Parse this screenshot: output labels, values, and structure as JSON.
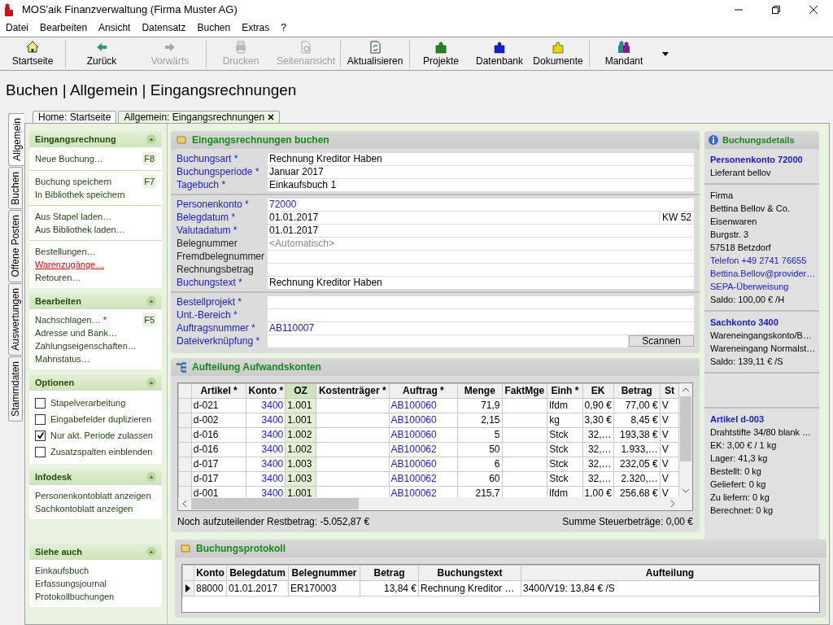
{
  "window": {
    "title": "MOS'aik Finanzverwaltung (Firma Muster AG)"
  },
  "menu": [
    "Datei",
    "Bearbeiten",
    "Ansicht",
    "Datensatz",
    "Buchen",
    "Extras",
    "?"
  ],
  "toolbar": [
    {
      "label": "Startseite",
      "disabled": false
    },
    {
      "label": "Zurück",
      "disabled": false
    },
    {
      "label": "Vorwärts",
      "disabled": true
    },
    {
      "label": "Drucken",
      "disabled": true
    },
    {
      "label": "Seitenansicht",
      "disabled": true
    },
    {
      "label": "Aktualisieren",
      "disabled": false
    },
    {
      "label": "Projekte",
      "color": "#1a8a1a",
      "disabled": false
    },
    {
      "label": "Datenbank",
      "color": "#1020d0",
      "disabled": false
    },
    {
      "label": "Dokumente",
      "color": "#e8d800",
      "disabled": false
    },
    {
      "label": "Mandant",
      "disabled": false
    }
  ],
  "heading": "Buchen | Allgemein | Eingangsrechnungen",
  "side_tabs": [
    {
      "label": "Allgemein",
      "selected": true
    },
    {
      "label": "Buchen",
      "selected": false
    },
    {
      "label": "Offene Posten",
      "selected": false
    },
    {
      "label": "Auswertungen",
      "selected": false
    },
    {
      "label": "Stammdaten",
      "selected": false
    }
  ],
  "doc_tabs": [
    {
      "label": "Home: Startseite",
      "selected": false,
      "closable": false
    },
    {
      "label": "Allgemein: Eingangsrechnungen",
      "selected": true,
      "closable": true
    }
  ],
  "sidebar": [
    {
      "title": "Eingangsrechnung",
      "expanded": true,
      "groups": [
        [
          {
            "kind": "link",
            "text": "Neue Buchung…",
            "shortcut": "F8"
          }
        ],
        [
          {
            "kind": "link",
            "text": "Buchung speichern",
            "shortcut": "F7"
          },
          {
            "kind": "link",
            "text": "In Bibliothek speichern"
          }
        ],
        [
          {
            "kind": "link",
            "text": "Aus Stapel laden…"
          },
          {
            "kind": "link",
            "text": "Aus Bibliothek laden…"
          }
        ],
        [
          {
            "kind": "link",
            "text": "Bestellungen…"
          },
          {
            "kind": "link",
            "text": "Warenzugänge…",
            "hover": true
          },
          {
            "kind": "link",
            "text": "Retouren…"
          }
        ]
      ]
    },
    {
      "title": "Bearbeiten",
      "expanded": true,
      "groups": [
        [
          {
            "kind": "link",
            "text": "Nachschlagen… *",
            "shortcut": "F5"
          },
          {
            "kind": "link",
            "text": "Adresse und Bank…"
          },
          {
            "kind": "link",
            "text": "Zahlungseigenschaften…"
          },
          {
            "kind": "link",
            "text": "Mahnstatus…"
          }
        ]
      ]
    },
    {
      "title": "Optionen",
      "expanded": true,
      "groups": [
        [
          {
            "kind": "checkbox",
            "text": "Stapelverarbeitung",
            "checked": false
          },
          {
            "kind": "checkbox",
            "text": "Eingabefelder duplizieren",
            "checked": false
          },
          {
            "kind": "checkbox",
            "text": "Nur akt. Periode zulassen",
            "checked": true
          },
          {
            "kind": "checkbox",
            "text": "Zusatzspalten einblenden",
            "checked": false
          }
        ]
      ]
    },
    {
      "title": "Infodesk",
      "expanded": true,
      "groups": [
        [
          {
            "kind": "link",
            "text": "Personenkontoblatt anzeigen"
          },
          {
            "kind": "link",
            "text": "Sachkontoblatt anzeigen"
          }
        ]
      ]
    },
    {
      "title": "Siehe auch",
      "expanded": true,
      "groups": [
        [
          {
            "kind": "link",
            "text": "Einkaufsbuch"
          },
          {
            "kind": "link",
            "text": "Erfassungsjournal"
          },
          {
            "kind": "link",
            "text": "Protokollbuchungen"
          }
        ]
      ]
    }
  ],
  "form": {
    "title": "Eingangsrechnungen buchen",
    "groups": [
      [
        {
          "label": "Buchungsart *",
          "required": true,
          "value": "Rechnung Kreditor Haben"
        },
        {
          "label": "Buchungsperiode *",
          "required": true,
          "value": "Januar 2017"
        },
        {
          "label": "Tagebuch *",
          "required": true,
          "value": "Einkaufsbuch 1"
        }
      ],
      [
        {
          "label": "Personenkonto *",
          "required": true,
          "value": "72000",
          "link": true
        },
        {
          "label": "Belegdatum *",
          "required": true,
          "value": "01.01.2017",
          "suffix": "KW 52"
        },
        {
          "label": "Valutadatum *",
          "required": true,
          "value": "01.01.2017"
        },
        {
          "label": "Belegnummer",
          "required": false,
          "placeholder": "<Automatisch>"
        },
        {
          "label": "Fremdbelegnummer",
          "required": false
        },
        {
          "label": "Rechnungsbetrag",
          "required": false
        },
        {
          "label": "Buchungstext *",
          "required": true,
          "value": "Rechnung Kreditor Haben"
        }
      ],
      [
        {
          "label": "Bestellprojekt *",
          "required": true
        },
        {
          "label": "Unt.-Bereich *",
          "required": true
        },
        {
          "label": "Auftragsnummer *",
          "required": true,
          "value": "AB110007",
          "link": true
        },
        {
          "label": "Dateiverknüpfung *",
          "required": true,
          "button": "Scannen"
        }
      ]
    ]
  },
  "split": {
    "title": "Aufteilung Aufwandskonten",
    "columns": [
      {
        "label": "Artikel *"
      },
      {
        "label": "Konto *",
        "link": true
      },
      {
        "label": "OZ",
        "highlight": true
      },
      {
        "label": "Kostenträger *"
      },
      {
        "label": "Auftrag *",
        "link": true
      },
      {
        "label": "Menge"
      },
      {
        "label": "FaktMge"
      },
      {
        "label": "Einh *"
      },
      {
        "label": "EK"
      },
      {
        "label": "Betrag"
      },
      {
        "label": "St"
      }
    ],
    "rows": [
      [
        "d-021",
        "3400",
        "1.001",
        "",
        "AB100060",
        "71,9",
        "",
        "lfdm",
        "0,90 €",
        "77,00 €",
        "V"
      ],
      [
        "d-002",
        "3400",
        "1.001",
        "",
        "AB100060",
        "2,15",
        "",
        "kg",
        "3,30 €",
        "8,45 €",
        "V"
      ],
      [
        "d-016",
        "3400",
        "1.002",
        "",
        "AB100060",
        "5",
        "",
        "Stck",
        "32,…",
        "193,38 €",
        "V"
      ],
      [
        "d-016",
        "3400",
        "1.002",
        "",
        "AB100062",
        "50",
        "",
        "Stck",
        "32,…",
        "1.933,…",
        "V"
      ],
      [
        "d-017",
        "3400",
        "1.003",
        "",
        "AB100060",
        "6",
        "",
        "Stck",
        "32,…",
        "232,05 €",
        "V"
      ],
      [
        "d-017",
        "3400",
        "1.003",
        "",
        "AB100062",
        "60",
        "",
        "Stck",
        "32,…",
        "2.320,…",
        "V"
      ],
      [
        "d-001",
        "3400",
        "1.001",
        "",
        "AB100062",
        "215,7",
        "",
        "lfdm",
        "1,00 €",
        "256,68 €",
        "V"
      ]
    ],
    "remaining": "Noch aufzuteilender Restbetrag: -5.052,87 €",
    "tax_sum": "Summe Steuerbeträge: 0,00 €"
  },
  "details": {
    "title": "Buchungsdetails",
    "sections": [
      {
        "title": "Personenkonto 72000",
        "lines": [
          {
            "text": "Lieferant bellov"
          }
        ]
      },
      {
        "lines": [
          {
            "text": "Firma"
          },
          {
            "text": "Bettina Bellov & Co."
          },
          {
            "text": "Eisenwaren"
          },
          {
            "text": "Burgstr. 3"
          },
          {
            "text": "57518 Betzdorf"
          },
          {
            "text": "Telefon +49 2741 76655",
            "link": true
          },
          {
            "text": "Bettina.Bellov@provider…",
            "link": true
          },
          {
            "text": "SEPA-Überweisung",
            "link": true
          },
          {
            "text": "Saldo: 100,00 € /H"
          }
        ]
      },
      {
        "title": "Sachkonto 3400",
        "lines": [
          {
            "text": "Wareneingangskonto/B…"
          },
          {
            "text": "Wareneingang Normalst…"
          },
          {
            "text": "Saldo: 139,11 € /S"
          }
        ]
      },
      {
        "title": "Artikel d-003",
        "lines": [
          {
            "text": "Drahtstifte 34/80 blank …"
          },
          {
            "text": "EK: 3,00 € / 1 kg"
          },
          {
            "text": "Lager: 41,3 kg"
          },
          {
            "text": "Bestellt: 0 kg"
          },
          {
            "text": "Geliefert: 0 kg"
          },
          {
            "text": "Zu liefern: 0 kg"
          },
          {
            "text": "Berechnet: 0 kg"
          }
        ]
      }
    ]
  },
  "protocol": {
    "title": "Buchungsprotokoll",
    "columns": [
      "Konto",
      "Belegdatum",
      "Belegnummer",
      "Betrag",
      "Buchungstext",
      "Aufteilung"
    ],
    "rows": [
      {
        "current": true,
        "cells": [
          "88000",
          "01.01.2017",
          "ER170003",
          "13,84 €",
          "Rechnung Kreditor …",
          "3400/V19: 13,84 € /S"
        ]
      }
    ]
  }
}
